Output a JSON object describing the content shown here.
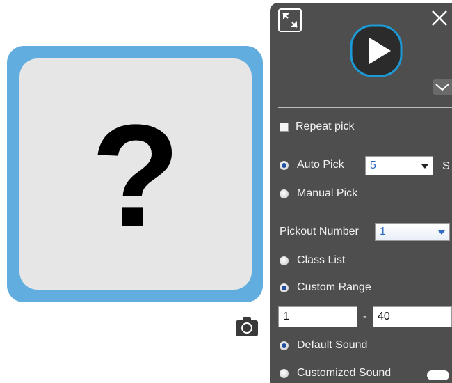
{
  "card": {
    "placeholder_symbol": "?"
  },
  "panel": {
    "repeat_pick_label": "Repeat pick",
    "auto_pick_label": "Auto Pick",
    "auto_pick_value": "5",
    "auto_pick_unit": "S",
    "manual_pick_label": "Manual Pick",
    "pickout_number_label": "Pickout Number",
    "pickout_number_value": "1",
    "class_list_label": "Class List",
    "custom_range_label": "Custom Range",
    "range_from": "1",
    "range_separator": "-",
    "range_to": "40",
    "default_sound_label": "Default Sound",
    "customized_sound_label": "Customized Sound"
  },
  "state": {
    "repeat_pick_checked": false,
    "pick_mode": "auto",
    "list_mode": "custom_range",
    "sound_mode": "default"
  },
  "colors": {
    "card_border": "#62ade0",
    "card_fill": "#e6e6e6",
    "panel_bg": "#4e4e4e",
    "play_ring": "#1d9ad6",
    "select_text": "#2f6bc1"
  },
  "icons": [
    "expand-icon",
    "close-icon",
    "play-icon",
    "chevron-down-icon",
    "camera-icon"
  ]
}
